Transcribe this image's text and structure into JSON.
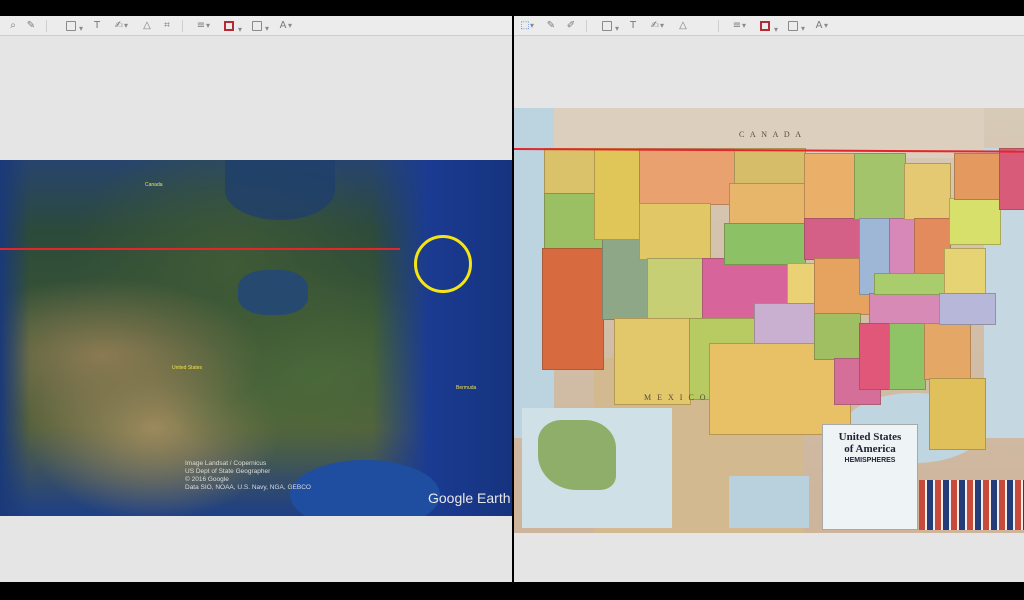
{
  "left_pane": {
    "toolbar_icons": [
      "zoom-icon",
      "pen-icon",
      "shapes-icon",
      "text-icon",
      "signature-icon",
      "adjust-color-icon",
      "crop-icon",
      "border-style-icon",
      "border-color-icon",
      "fill-color-icon",
      "font-icon"
    ],
    "earth_image": {
      "labels": {
        "canada": "Canada",
        "united_states": "United States",
        "bermuda": "Bermuda"
      },
      "credits": [
        "Image Landsat / Copernicus",
        "US Dept of State Geographer",
        "© 2016 Google",
        "Data SIO, NOAA, U.S. Navy, NGA, GEBCO"
      ],
      "watermark": "Google Earth"
    }
  },
  "right_pane": {
    "toolbar_icons": [
      "select-icon",
      "pen-icon",
      "sketch-icon",
      "shapes-icon",
      "text-icon",
      "signature-icon",
      "adjust-color-icon",
      "border-style-icon",
      "border-color-icon",
      "fill-color-icon",
      "font-icon"
    ],
    "wall_map": {
      "labels": {
        "canada": "C A N A D A",
        "mexico": "M E X I C O"
      },
      "inset": {
        "title_line1": "United States",
        "title_line2": "of America",
        "publisher": "HEMISPHERES"
      }
    }
  },
  "colors": {
    "reference_line": "#e3262b",
    "highlight_circle": "#f5e514"
  }
}
